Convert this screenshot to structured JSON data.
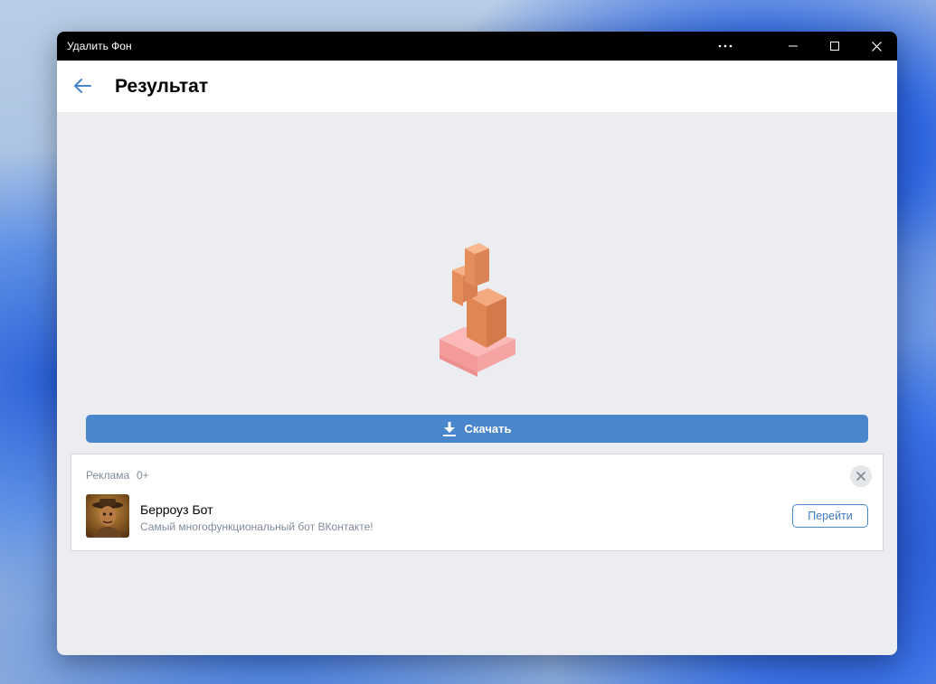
{
  "window": {
    "title": "Удалить Фон"
  },
  "header": {
    "title": "Результат"
  },
  "actions": {
    "download_label": "Скачать"
  },
  "ad": {
    "label": "Реклама",
    "age_rating": "0+",
    "name": "Берроуз Бот",
    "description": "Самый многофункциональный бот ВКонтакте!",
    "cta_label": "Перейти"
  },
  "icons": {
    "back": "arrow-left-icon",
    "more": "more-horizontal-icon",
    "minimize": "minimize-icon",
    "maximize": "maximize-icon",
    "close": "close-icon",
    "download": "download-icon",
    "ad_close": "close-icon"
  },
  "colors": {
    "accent": "#4a86cb",
    "titlebar": "#000000",
    "content_bg": "#ebedf0",
    "secondary_text": "#818c99"
  }
}
